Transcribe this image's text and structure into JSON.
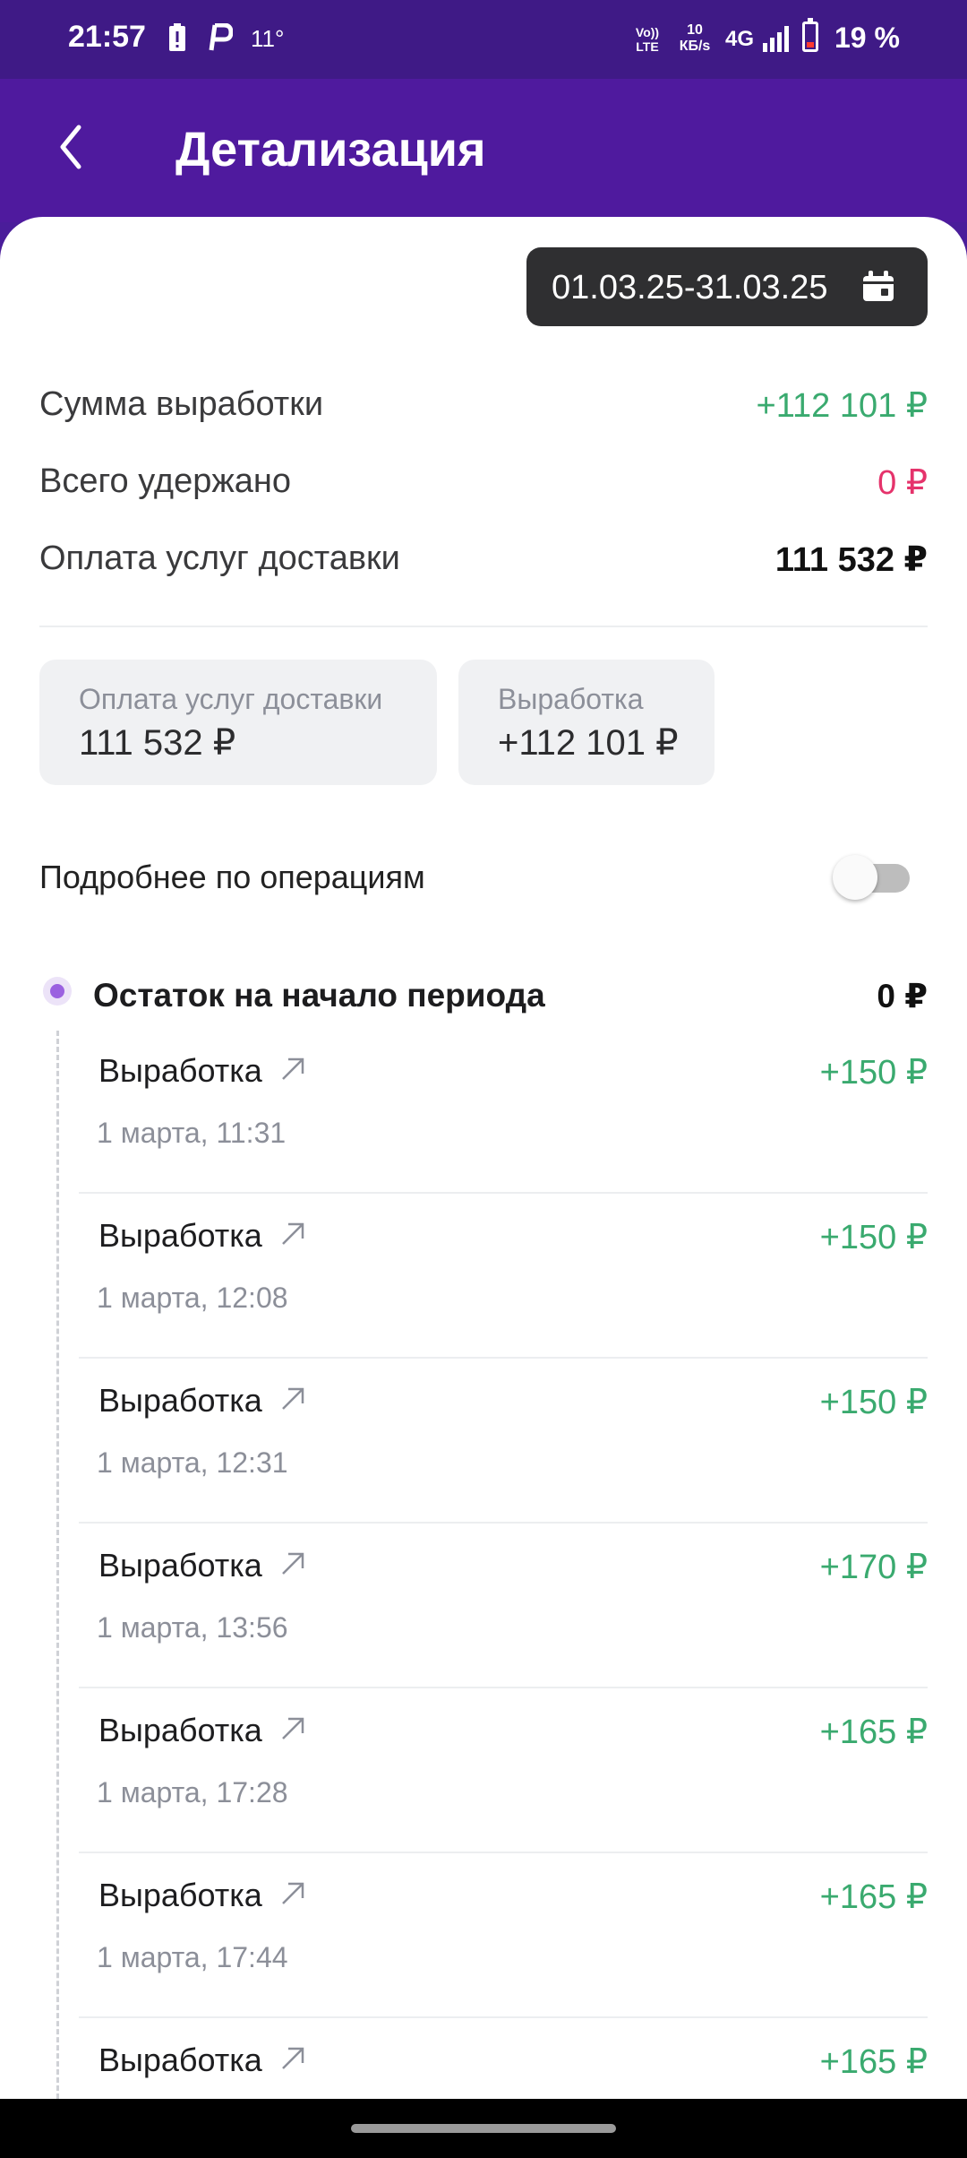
{
  "status_bar": {
    "time": "21:57",
    "notif_icons": [
      "alert-battery-icon",
      "ruble-app-icon"
    ],
    "temperature": "11°",
    "volte": "Vo)) LTE",
    "net_speed_value": "10",
    "net_speed_unit": "КБ/s",
    "network": "4G",
    "battery_pct": "19 %"
  },
  "header": {
    "title": "Детализация",
    "back_icon": "back-arrow-icon"
  },
  "date_filter": {
    "range": "01.03.25-31.03.25",
    "icon": "calendar-icon"
  },
  "summary": [
    {
      "label": "Сумма выработки",
      "value": "+112 101 ₽",
      "color": "#3aaa6f"
    },
    {
      "label": "Всего удержано",
      "value": "0 ₽",
      "color": "#e5336b"
    },
    {
      "label": "Оплата услуг доставки",
      "value": "111 532 ₽",
      "color": "#111111"
    }
  ],
  "chips": [
    {
      "label": "Оплата услуг доставки",
      "value": "111 532 ₽"
    },
    {
      "label": "Выработка",
      "value": "+112 101 ₽"
    }
  ],
  "details_toggle": {
    "label": "Подробнее по операциям",
    "enabled": false
  },
  "balance": {
    "label": "Остаток на начало периода",
    "value": "0 ₽"
  },
  "transactions": [
    {
      "label": "Выработка",
      "date": "1 марта, 11:31",
      "amount": "+150 ₽"
    },
    {
      "label": "Выработка",
      "date": "1 марта, 12:08",
      "amount": "+150 ₽"
    },
    {
      "label": "Выработка",
      "date": "1 марта, 12:31",
      "amount": "+150 ₽"
    },
    {
      "label": "Выработка",
      "date": "1 марта, 13:56",
      "amount": "+170 ₽"
    },
    {
      "label": "Выработка",
      "date": "1 марта, 17:28",
      "amount": "+165 ₽"
    },
    {
      "label": "Выработка",
      "date": "1 марта, 17:44",
      "amount": "+165 ₽"
    },
    {
      "label": "Выработка",
      "date": "",
      "amount": "+165 ₽"
    }
  ],
  "colors": {
    "header_bg": "#4f1a9e",
    "positive": "#3aaa6f",
    "negative": "#e5336b",
    "accent_dot": "#9b62e0"
  }
}
